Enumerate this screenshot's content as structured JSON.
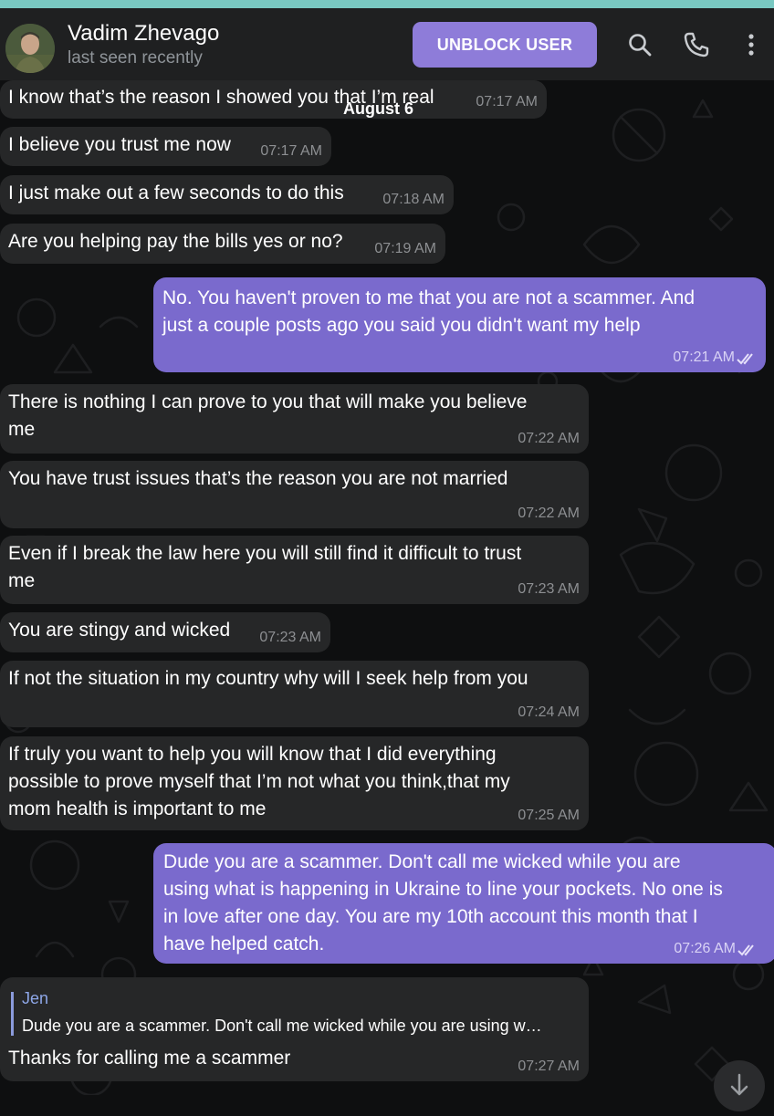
{
  "header": {
    "contact_name": "Vadim Zhevago",
    "status": "last seen recently",
    "unblock_label": "UNBLOCK USER",
    "icons": [
      "search-icon",
      "phone-icon",
      "more-vertical-icon"
    ]
  },
  "date_chip": "August 6",
  "messages": [
    {
      "dir": "in",
      "text": "I know that’s the reason I showed you that I’m real",
      "time": "07:17 AM"
    },
    {
      "dir": "in",
      "text": "I believe you trust me now",
      "time": "07:17 AM"
    },
    {
      "dir": "in",
      "text": "I just make out a few seconds to do this",
      "time": "07:18 AM"
    },
    {
      "dir": "in",
      "text": "Are you helping pay the bills yes or no?",
      "time": "07:19 AM"
    },
    {
      "dir": "out",
      "lines": [
        "No. You haven't proven to me that you are not a scammer. And",
        "just a couple posts ago you said you didn't want my help"
      ],
      "time": "07:21 AM"
    },
    {
      "dir": "in",
      "lines": [
        "There is nothing I can prove to you that will make you believe",
        "me"
      ],
      "time": "07:22 AM"
    },
    {
      "dir": "in",
      "text": "You have trust issues that’s the reason you are not married",
      "time": "07:22 AM"
    },
    {
      "dir": "in",
      "lines": [
        "Even if I break the law here you will still find it difficult to trust",
        "me"
      ],
      "time": "07:23 AM"
    },
    {
      "dir": "in",
      "text": "You are stingy and wicked",
      "time": "07:23 AM"
    },
    {
      "dir": "in",
      "text": "If not the situation in my country why will I seek help from you",
      "time": "07:24 AM"
    },
    {
      "dir": "in",
      "lines": [
        "If truly you want to help you will know that I did everything",
        "possible to prove myself that I’m not what you think,that my",
        "mom health is important to me"
      ],
      "time": "07:25 AM"
    },
    {
      "dir": "out",
      "lines": [
        "Dude you are a scammer. Don't call me wicked while you are",
        "using what is happening in Ukraine to line your pockets. No one is",
        "in love after one day. You are my 10th account this month that I",
        "have helped catch."
      ],
      "time": "07:26 AM"
    },
    {
      "dir": "in",
      "reply_name": "Jen",
      "reply_text": "Dude you are a scammer. Don't call me wicked while you are using w…",
      "text": "Thanks for calling me a scammer",
      "time": "07:27 AM"
    }
  ],
  "colors": {
    "header_bg": "#1f2021",
    "top_strip": "#79c9c2",
    "incoming_bubble": "#262728",
    "outgoing_bubble": "#7a6acd",
    "accent_button": "#8e7cd9"
  }
}
